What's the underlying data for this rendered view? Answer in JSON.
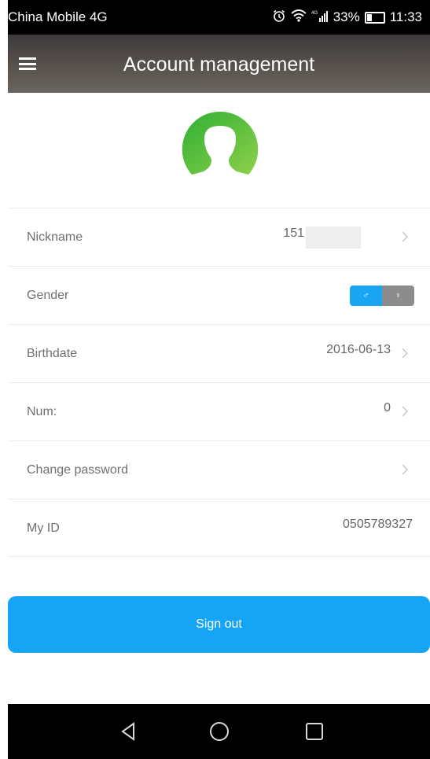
{
  "status_bar": {
    "carrier": "China Mobile 4G",
    "battery": "33%",
    "time": "11:33",
    "icons": [
      "alarm-icon",
      "wifi-icon",
      "signal-icon",
      "battery-icon"
    ]
  },
  "header": {
    "title": "Account management",
    "menu_icon": "hamburger-icon"
  },
  "profile": {
    "avatar_icon": "user-avatar-icon",
    "avatar_color": "#3db43a"
  },
  "rows": {
    "nickname": {
      "label": "Nickname",
      "value": "151"
    },
    "gender": {
      "label": "Gender",
      "male_symbol": "♂",
      "female_symbol": "♀",
      "selected": "male"
    },
    "birthdate": {
      "label": "Birthdate",
      "value": "2016-06-13"
    },
    "num": {
      "label": "Num:",
      "value": "0"
    },
    "change_password": {
      "label": "Change password"
    },
    "my_id": {
      "label": "My ID",
      "value": "0505789327"
    }
  },
  "signout": {
    "label": "Sign out",
    "color": "#16a5f5"
  },
  "nav_bar": {
    "buttons": [
      "back-icon",
      "home-icon",
      "recents-icon"
    ]
  }
}
